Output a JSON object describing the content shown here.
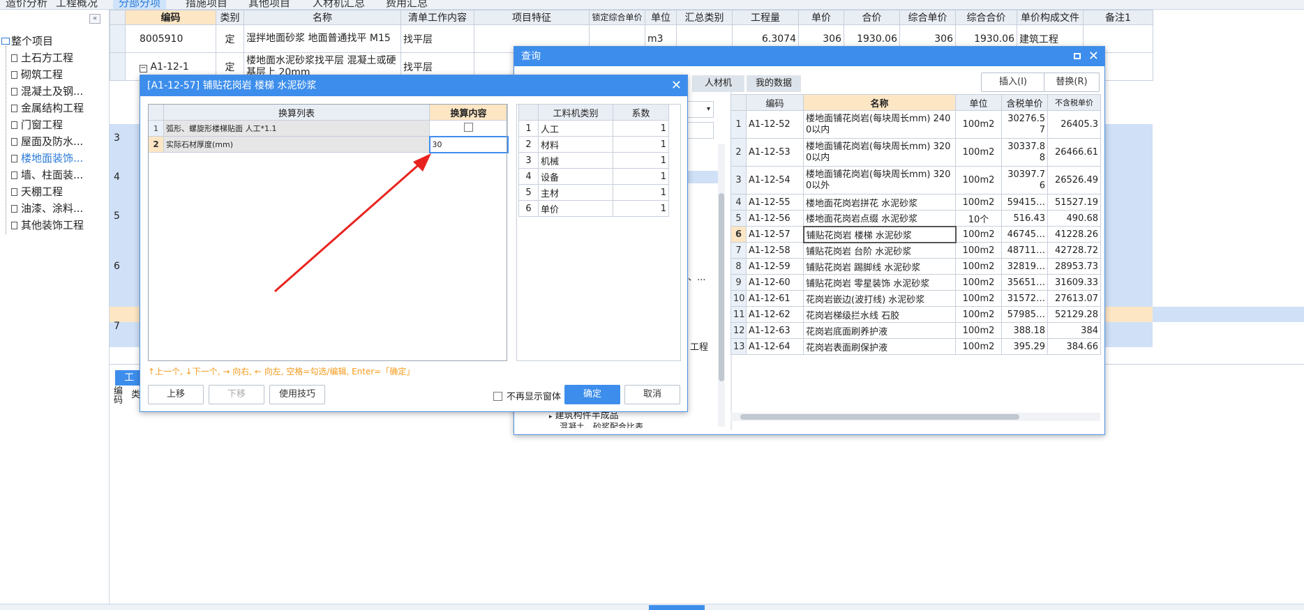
{
  "top_tabs": [
    {
      "label": "造价分析",
      "active": false
    },
    {
      "label": "工程概况",
      "active": false
    },
    {
      "label": "分部分项",
      "active": true
    },
    {
      "label": "措施项目",
      "active": false
    },
    {
      "label": "其他项目",
      "active": false
    },
    {
      "label": "人材机汇总",
      "active": false
    },
    {
      "label": "费用汇总",
      "active": false
    }
  ],
  "tree": {
    "collapse": "«",
    "root": "整个项目",
    "items": [
      "土石方工程",
      "砌筑工程",
      "混凝土及钢...",
      "金属结构工程",
      "门窗工程",
      "屋面及防水...",
      "楼地面装饰...",
      "墙、柱面装...",
      "天棚工程",
      "油漆、涂料...",
      "其他装饰工程"
    ],
    "selected_index": 6
  },
  "main_grid": {
    "headers": [
      "编码",
      "类别",
      "名称",
      "清单工作内容",
      "项目特征",
      "锁定综合单价",
      "单位",
      "汇总类别",
      "工程量",
      "单价",
      "合价",
      "综合单价",
      "综合合价",
      "单价构成文件",
      "备注1"
    ],
    "row1": {
      "code": "8005910",
      "type": "定",
      "name": "湿拌地面砂浆 地面普通找平 M15",
      "content": "找平层",
      "unit": "m3",
      "qty": "6.3074",
      "price": "306",
      "total": "1930.06",
      "uprice": "306",
      "utotal": "1930.06",
      "file": "建筑工程"
    },
    "row2": {
      "code": "A1-12-1",
      "type": "定",
      "name": "楼地面水泥砂浆找平层 混凝土或硬基层上 20mm",
      "content": "找平层"
    },
    "row_nums": [
      "3",
      "4",
      "5",
      "6",
      "7"
    ],
    "bottom_tab": "工",
    "bottom_cols": [
      "编码",
      "类"
    ]
  },
  "query_dialog": {
    "title": "查询",
    "tabs": [
      "人材机",
      "我的数据"
    ],
    "insert_btn": "插入(I)",
    "replace_btn": "替换(R)",
    "tree_fragments": [
      "块、...",
      "工程",
      "建筑构件半成品",
      "混凝土、砂浆配合比表"
    ],
    "columns": [
      "编码",
      "名称",
      "单位",
      "含税单价",
      "不含税单价"
    ],
    "rows": [
      {
        "n": "1",
        "code": "A1-12-52",
        "name": "楼地面铺花岗岩(每块周长mm) 2400以内",
        "unit": "100m2",
        "tax": "30276.57",
        "notax": "26405.3"
      },
      {
        "n": "2",
        "code": "A1-12-53",
        "name": "楼地面铺花岗岩(每块周长mm) 3200以内",
        "unit": "100m2",
        "tax": "30337.88",
        "notax": "26466.61"
      },
      {
        "n": "3",
        "code": "A1-12-54",
        "name": "楼地面铺花岗岩(每块周长mm) 3200以外",
        "unit": "100m2",
        "tax": "30397.76",
        "notax": "26526.49"
      },
      {
        "n": "4",
        "code": "A1-12-55",
        "name": "楼地面花岗岩拼花 水泥砂浆",
        "unit": "100m2",
        "tax": "59415…",
        "notax": "51527.19"
      },
      {
        "n": "5",
        "code": "A1-12-56",
        "name": "楼地面花岗岩点缀 水泥砂浆",
        "unit": "10个",
        "tax": "516.43",
        "notax": "490.68"
      },
      {
        "n": "6",
        "code": "A1-12-57",
        "name": "铺贴花岗岩 楼梯 水泥砂浆",
        "unit": "100m2",
        "tax": "46745…",
        "notax": "41228.26"
      },
      {
        "n": "7",
        "code": "A1-12-58",
        "name": "铺贴花岗岩 台阶 水泥砂浆",
        "unit": "100m2",
        "tax": "48711…",
        "notax": "42728.72"
      },
      {
        "n": "8",
        "code": "A1-12-59",
        "name": "铺贴花岗岩 踢脚线 水泥砂浆",
        "unit": "100m2",
        "tax": "32819…",
        "notax": "28953.73"
      },
      {
        "n": "9",
        "code": "A1-12-60",
        "name": "铺贴花岗岩 零星装饰 水泥砂浆",
        "unit": "100m2",
        "tax": "35651…",
        "notax": "31609.33"
      },
      {
        "n": "10",
        "code": "A1-12-61",
        "name": "花岗岩嵌边(波打线) 水泥砂浆",
        "unit": "100m2",
        "tax": "31572…",
        "notax": "27613.07"
      },
      {
        "n": "11",
        "code": "A1-12-62",
        "name": "花岗岩梯级拦水线 石胶",
        "unit": "100m2",
        "tax": "57985…",
        "notax": "52129.28"
      },
      {
        "n": "12",
        "code": "A1-12-63",
        "name": "花岗岩底面刷养护液",
        "unit": "100m2",
        "tax": "388.18",
        "notax": "384"
      },
      {
        "n": "13",
        "code": "A1-12-64",
        "name": "花岗岩表面刷保护液",
        "unit": "100m2",
        "tax": "395.29",
        "notax": "384.66"
      }
    ],
    "selected_row": 5
  },
  "conv_dialog": {
    "title": "[A1-12-57] 铺贴花岗岩 楼梯 水泥砂浆",
    "left_headers": [
      "换算列表",
      "换算内容"
    ],
    "left_rows": [
      {
        "n": "1",
        "label": "弧形、螺旋形楼梯贴面 人工*1.1",
        "value": ""
      },
      {
        "n": "2",
        "label": "实际石材厚度(mm)",
        "value": "30"
      }
    ],
    "right_headers": [
      "工料机类别",
      "系数"
    ],
    "right_rows": [
      {
        "n": "1",
        "cat": "人工",
        "coef": "1"
      },
      {
        "n": "2",
        "cat": "材料",
        "coef": "1"
      },
      {
        "n": "3",
        "cat": "机械",
        "coef": "1"
      },
      {
        "n": "4",
        "cat": "设备",
        "coef": "1"
      },
      {
        "n": "5",
        "cat": "主材",
        "coef": "1"
      },
      {
        "n": "6",
        "cat": "单价",
        "coef": "1"
      }
    ],
    "hint": "↑上一个, ↓下一个, → 向右, ← 向左, 空格=勾选/编辑, Enter=「确定」",
    "btn_up": "上移",
    "btn_down": "下移",
    "btn_tips": "使用技巧",
    "no_show": "不再显示窗体",
    "btn_ok": "确定",
    "btn_cancel": "取消"
  },
  "colors": {
    "accent": "#3d8eec",
    "arrow": "#e8231f",
    "highlight": "#fde6c4"
  }
}
